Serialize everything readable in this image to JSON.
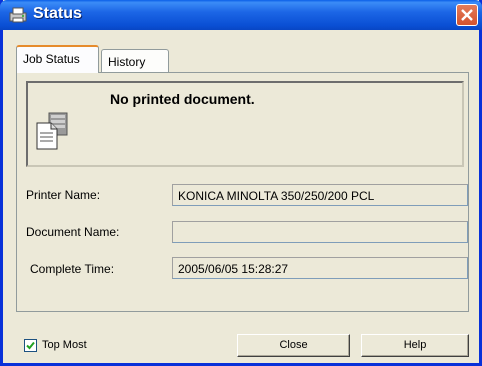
{
  "window": {
    "title": "Status",
    "icon": "printer-status-icon",
    "close_icon": "close-icon"
  },
  "tabs": [
    {
      "label": "Job Status",
      "active": true
    },
    {
      "label": "History",
      "active": false
    }
  ],
  "status": {
    "message": "No printed document.",
    "icon": "document-icon"
  },
  "fields": {
    "printer_name": {
      "label": "Printer Name:",
      "value": "KONICA MINOLTA 350/250/200 PCL"
    },
    "document_name": {
      "label": "Document Name:",
      "value": ""
    },
    "complete_time": {
      "label": "Complete Time:",
      "value": "2005/06/05 15:28:27"
    }
  },
  "footer": {
    "top_most": {
      "label": "Top Most",
      "checked": true
    },
    "close_label": "Close",
    "help_label": "Help"
  },
  "colors": {
    "titlebar": "#0a4fd4",
    "close_button": "#d4532e",
    "window_bg": "#ece9d8",
    "active_tab_accent": "#e68b2c"
  }
}
